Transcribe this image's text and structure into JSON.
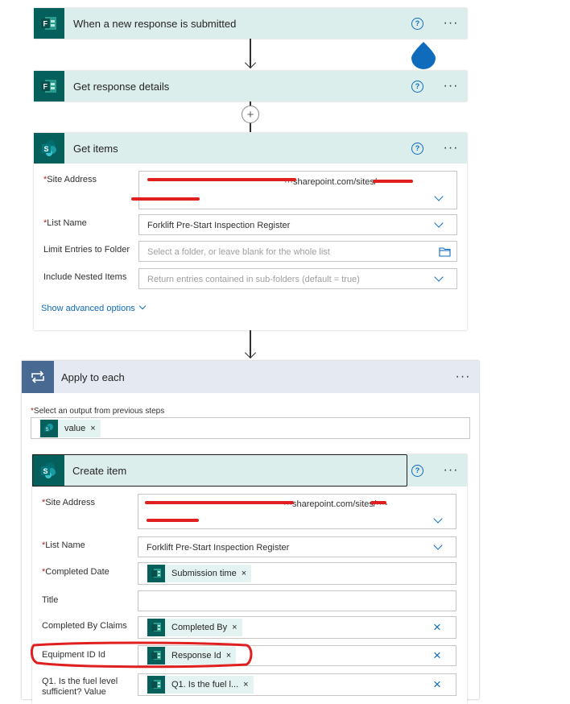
{
  "trigger": {
    "title": "When a new response is submitted",
    "help": "?",
    "more": "···"
  },
  "get_response": {
    "title": "Get response details",
    "help": "?",
    "more": "···"
  },
  "insert_step": {
    "symbol": "+"
  },
  "get_items": {
    "title": "Get items",
    "help": "?",
    "more": "···",
    "site_address": {
      "label": "Site Address",
      "value": "···sharepoint.com/sites/···-"
    },
    "list_name": {
      "label": "List Name",
      "value": "Forklift Pre-Start Inspection Register"
    },
    "limit_folder": {
      "label": "Limit Entries to Folder",
      "placeholder": "Select a folder, or leave blank for the whole list"
    },
    "nested_items": {
      "label": "Include Nested Items",
      "placeholder": "Return entries contained in sub-folders (default = true)"
    },
    "show_advanced": "Show advanced options"
  },
  "apply_each": {
    "title": "Apply to each",
    "more": "···",
    "output_label": "Select an output from previous steps",
    "output_token": "value"
  },
  "create_item": {
    "title": "Create item",
    "help": "?",
    "more": "···",
    "site_address": {
      "label": "Site Address",
      "value": "···sharepoint.com/sites/···-"
    },
    "list_name": {
      "label": "List Name",
      "value": "Forklift Pre-Start Inspection Register"
    },
    "completed_date": {
      "label": "Completed Date",
      "token": "Submission time"
    },
    "title_field": {
      "label": "Title"
    },
    "completed_by": {
      "label": "Completed By Claims",
      "token": "Completed By"
    },
    "equipment_id": {
      "label": "Equipment ID Id",
      "token": "Response Id"
    },
    "q1": {
      "label_line1": "Q1. Is the fuel level",
      "label_line2": "sufficient? Value",
      "token": "Q1. Is the fuel l..."
    }
  },
  "icons": {
    "forms": "forms-icon",
    "sharepoint": "sharepoint-icon",
    "loop": "loop-icon"
  },
  "colors": {
    "forms_header": "#dbeeec",
    "icon_bg": "#055f5a",
    "loop_header": "#e4e9f2",
    "accent": "#0f6cbd",
    "annotation": "#e02020"
  }
}
